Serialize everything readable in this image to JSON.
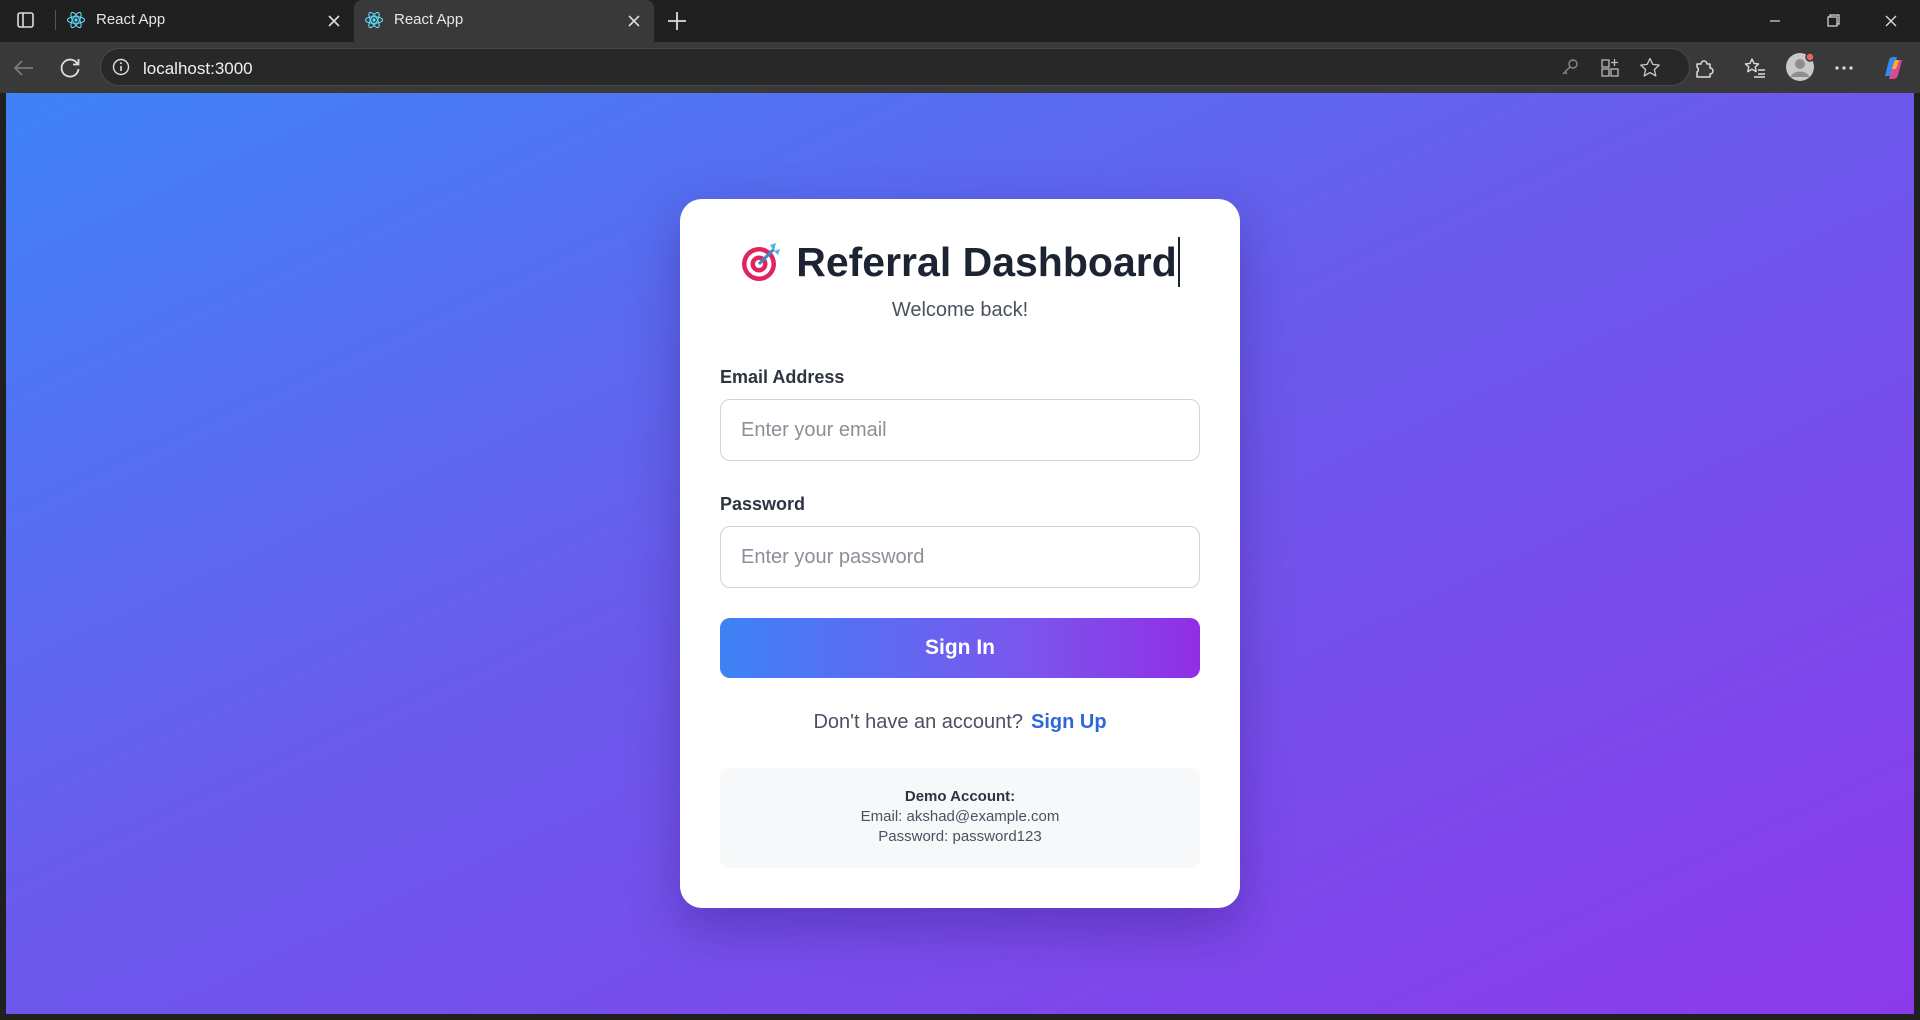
{
  "browser": {
    "tabs": [
      {
        "title": "React App",
        "icon": "react-icon"
      },
      {
        "title": "React App",
        "icon": "react-icon"
      }
    ],
    "url": "localhost:3000",
    "colors": {
      "chrome": "#202020",
      "toolbar": "#393939"
    }
  },
  "page": {
    "title": "Referral Dashboard",
    "title_icon": "target-dart-icon",
    "subtitle": "Welcome back!",
    "email_label": "Email Address",
    "email_placeholder": "Enter your email",
    "password_label": "Password",
    "password_placeholder": "Enter your password",
    "signin_label": "Sign In",
    "signup_prompt": "Don't have an account?",
    "signup_link": "Sign Up",
    "demo": {
      "title": "Demo Account:",
      "email": "Email: akshad@example.com",
      "password": "Password: password123"
    },
    "colors": {
      "gradient_start": "#3f83f6",
      "gradient_end": "#8b3aea",
      "link": "#2f68d6"
    }
  }
}
